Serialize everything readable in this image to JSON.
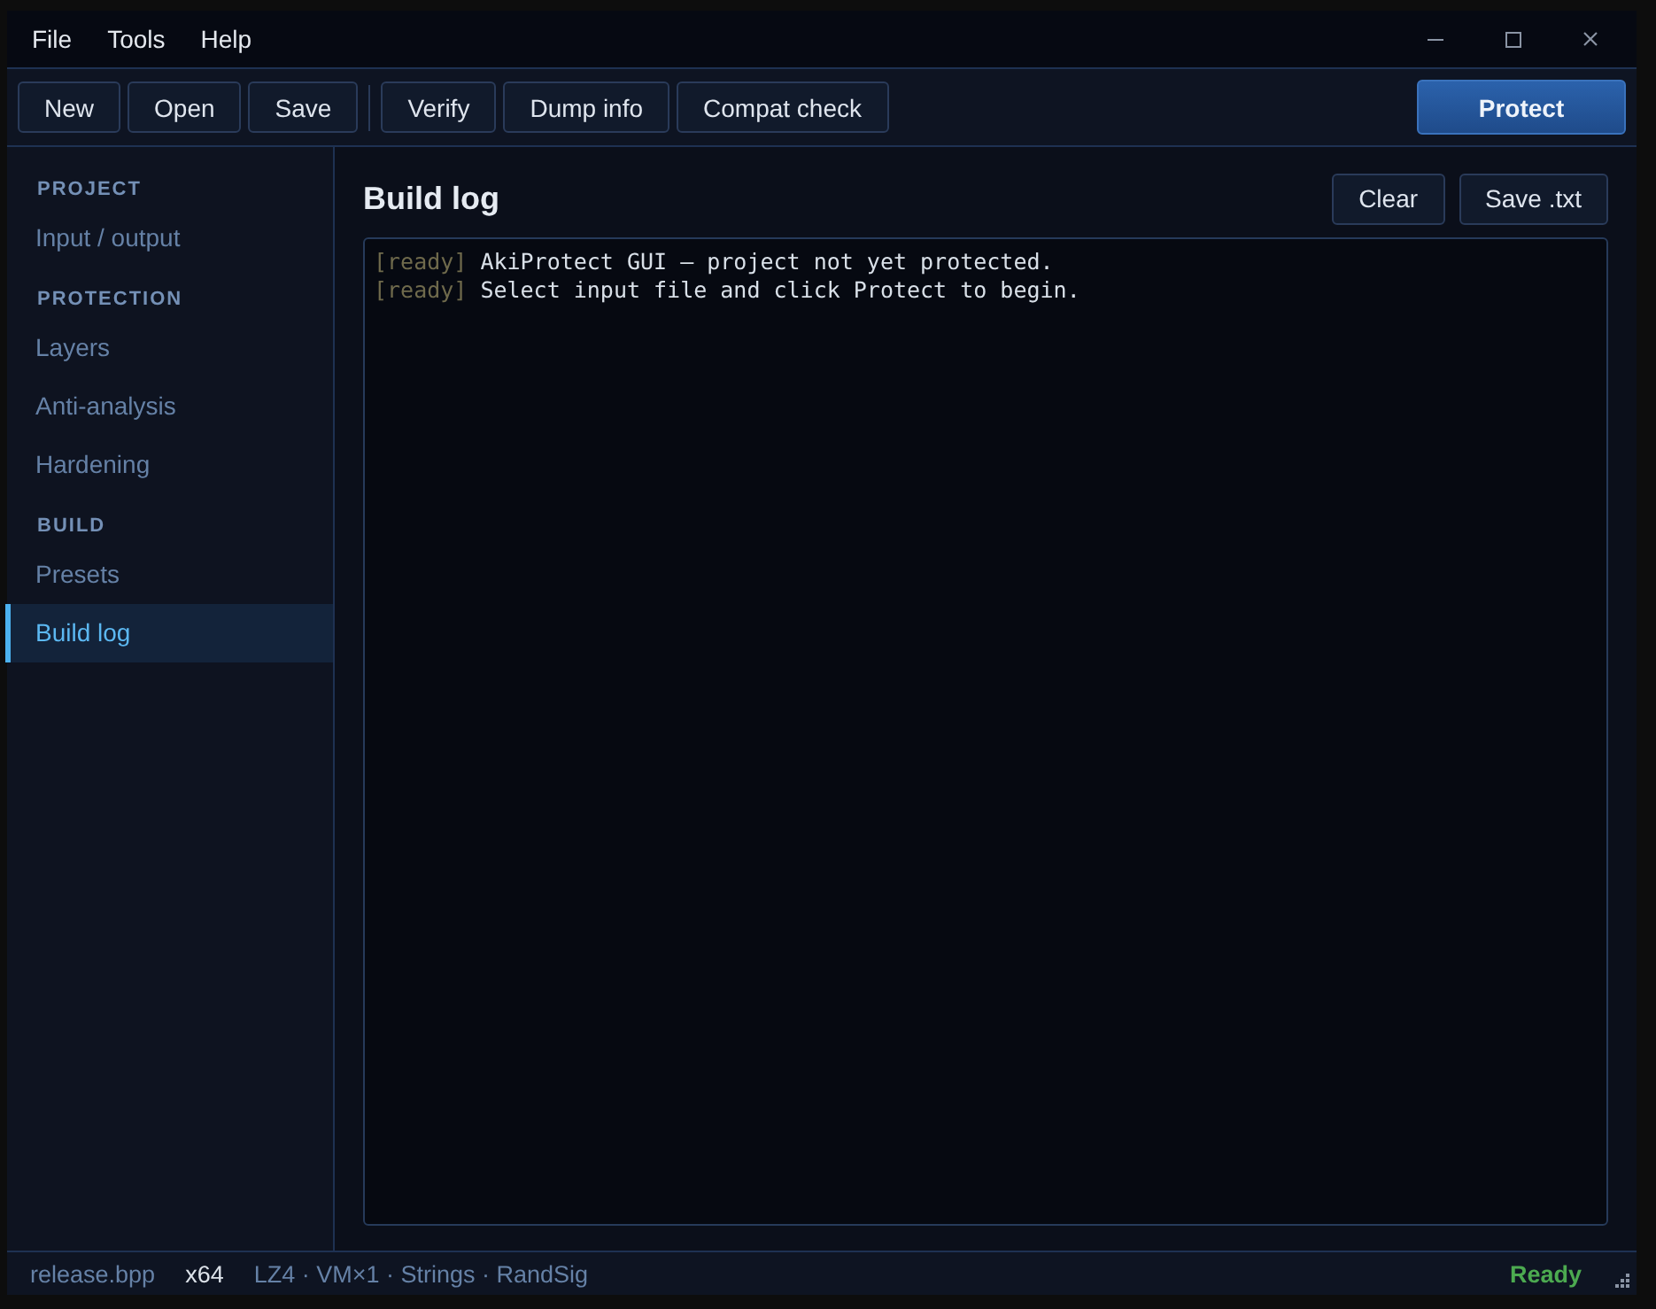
{
  "menu": [
    {
      "label": "File"
    },
    {
      "label": "Tools"
    },
    {
      "label": "Help"
    }
  ],
  "toolbar": {
    "groups": [
      [
        "New",
        "Open",
        "Save"
      ],
      [
        "Verify",
        "Dump info",
        "Compat check"
      ]
    ],
    "primary": "Protect"
  },
  "sidebar": {
    "sections": [
      {
        "title": "PROJECT",
        "items": [
          {
            "label": "Input / output",
            "selected": false
          }
        ]
      },
      {
        "title": "PROTECTION",
        "items": [
          {
            "label": "Layers",
            "selected": false
          },
          {
            "label": "Anti-analysis",
            "selected": false
          },
          {
            "label": "Hardening",
            "selected": false
          }
        ]
      },
      {
        "title": "BUILD",
        "items": [
          {
            "label": "Presets",
            "selected": false
          },
          {
            "label": "Build log",
            "selected": true
          }
        ]
      }
    ]
  },
  "page": {
    "title": "Build log",
    "actions": [
      "Clear",
      "Save .txt"
    ],
    "log": [
      {
        "tag": "[ready]",
        "message": "AkiProtect GUI — project not yet protected."
      },
      {
        "tag": "[ready]",
        "message": "Select input file and click Protect to begin."
      }
    ]
  },
  "status_bar": {
    "file": "release.bpp",
    "arch": "x64",
    "summary": "LZ4 · VM×1 · Strings · RandSig",
    "state": "Ready"
  }
}
